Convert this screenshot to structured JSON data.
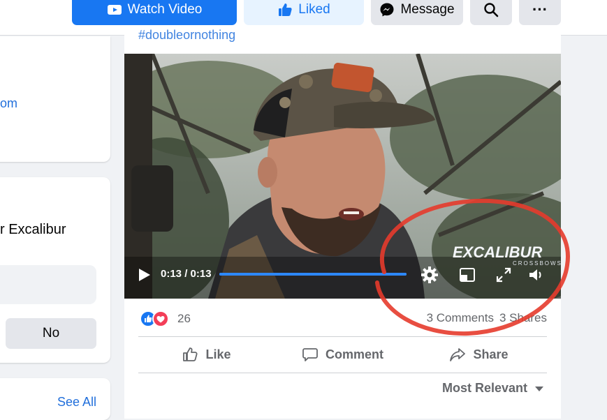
{
  "toolbar": {
    "watch_label": "Watch Video",
    "liked_label": "Liked",
    "message_label": "Message",
    "search_icon": "search-icon",
    "more_label": "···"
  },
  "sidebar": {
    "link_partial": "om",
    "prompt_partial": "r Excalibur",
    "no_label": "No",
    "see_all": "See All"
  },
  "post": {
    "hashtag": "#doubleornothing",
    "video": {
      "time": "0:13 / 0:13",
      "progress_fraction": 1.0,
      "watermark": "EXCALIBUR",
      "watermark_sub": "CROSSBOWS"
    },
    "reactions_count": "26",
    "comments": "3 Comments",
    "shares": "3 Shares",
    "actions": {
      "like": "Like",
      "comment": "Comment",
      "share": "Share"
    },
    "sort_label": "Most Relevant"
  },
  "colors": {
    "accent": "#1877f2",
    "annotation": "#e53b2c"
  }
}
